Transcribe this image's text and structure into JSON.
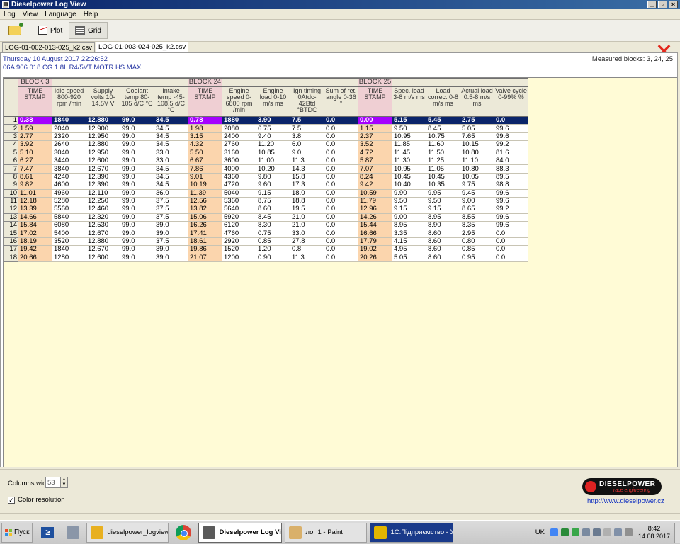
{
  "window": {
    "title": "Dieselpower Log View",
    "buttons": {
      "minimize": "_",
      "maximize": "▫",
      "close": "×"
    }
  },
  "menu": [
    "Log",
    "View",
    "Language",
    "Help"
  ],
  "toolbar": {
    "plot_label": "Plot",
    "grid_label": "Grid"
  },
  "file_tabs": [
    "LOG-01-002-013-025_k2.csv",
    "LOG-01-003-024-025_k2.csv"
  ],
  "info": {
    "date": "Thursday 10 August 2017 22:26:52",
    "engine": "06A 906 018 CG  1.8L R4/5VT MOTR HS MAX",
    "measured_blocks": "Measured blocks: 3, 24, 25"
  },
  "grid": {
    "blocks": [
      {
        "label": "BLOCK 3",
        "span": 1
      },
      {
        "label": "",
        "span": 4
      },
      {
        "label": "BLOCK 24",
        "span": 1
      },
      {
        "label": "",
        "span": 4
      },
      {
        "label": "BLOCK 25",
        "span": 1
      },
      {
        "label": "",
        "span": 4
      }
    ],
    "columns": [
      {
        "label": "TIME STAMP",
        "ts": true,
        "width": 48
      },
      {
        "label": "Idle speed 800-920 rpm /min",
        "width": 48
      },
      {
        "label": "Supply volts 10-14.5V V",
        "width": 48
      },
      {
        "label": "Coolant temp 80-105 d/C °C",
        "width": 48
      },
      {
        "label": "Intake temp -45-108.5 d/C °C",
        "width": 48
      },
      {
        "label": "TIME STAMP",
        "ts": true,
        "width": 48
      },
      {
        "label": "Engine speed 0-6800 rpm /min",
        "width": 48
      },
      {
        "label": "Engine load 0-10 m/s ms",
        "width": 48
      },
      {
        "label": "Ign timing 0Atdc-42Btd °BTDC",
        "width": 48
      },
      {
        "label": "Sum of ret. angle 0-36 °",
        "width": 48
      },
      {
        "label": "TIME STAMP",
        "ts": true,
        "width": 48
      },
      {
        "label": "Spec. load 3-8 m/s ms",
        "width": 48
      },
      {
        "label": "Load correc. 0-8 m/s ms",
        "width": 48
      },
      {
        "label": "Actual load 0.5-8 m/s ms",
        "width": 48
      },
      {
        "label": "Valve cycle 0-99% %",
        "width": 48
      }
    ],
    "selected_row": 0,
    "rows": [
      [
        "0.38",
        "1840",
        "12.880",
        "99.0",
        "34.5",
        "0.78",
        "1880",
        "3.90",
        "7.5",
        "0.0",
        "0.00",
        "5.15",
        "5.45",
        "2.75",
        "0.0"
      ],
      [
        "1.59",
        "2040",
        "12.900",
        "99.0",
        "34.5",
        "1.98",
        "2080",
        "6.75",
        "7.5",
        "0.0",
        "1.15",
        "9.50",
        "8.45",
        "5.05",
        "99.6"
      ],
      [
        "2.77",
        "2320",
        "12.950",
        "99.0",
        "34.5",
        "3.15",
        "2400",
        "9.40",
        "3.8",
        "0.0",
        "2.37",
        "10.95",
        "10.75",
        "7.65",
        "99.6"
      ],
      [
        "3.92",
        "2640",
        "12.880",
        "99.0",
        "34.5",
        "4.32",
        "2760",
        "11.20",
        "6.0",
        "0.0",
        "3.52",
        "11.85",
        "11.60",
        "10.15",
        "99.2"
      ],
      [
        "5.10",
        "3040",
        "12.950",
        "99.0",
        "33.0",
        "5.50",
        "3160",
        "10.85",
        "9.0",
        "0.0",
        "4.72",
        "11.45",
        "11.50",
        "10.80",
        "81.6"
      ],
      [
        "6.27",
        "3440",
        "12.600",
        "99.0",
        "33.0",
        "6.67",
        "3600",
        "11.00",
        "11.3",
        "0.0",
        "5.87",
        "11.30",
        "11.25",
        "11.10",
        "84.0"
      ],
      [
        "7.47",
        "3840",
        "12.670",
        "99.0",
        "34.5",
        "7.86",
        "4000",
        "10.20",
        "14.3",
        "0.0",
        "7.07",
        "10.95",
        "11.05",
        "10.80",
        "88.3"
      ],
      [
        "8.61",
        "4240",
        "12.390",
        "99.0",
        "34.5",
        "9.01",
        "4360",
        "9.80",
        "15.8",
        "0.0",
        "8.24",
        "10.45",
        "10.45",
        "10.05",
        "89.5"
      ],
      [
        "9.82",
        "4600",
        "12.390",
        "99.0",
        "34.5",
        "10.19",
        "4720",
        "9.60",
        "17.3",
        "0.0",
        "9.42",
        "10.40",
        "10.35",
        "9.75",
        "98.8"
      ],
      [
        "11.01",
        "4960",
        "12.110",
        "99.0",
        "36.0",
        "11.39",
        "5040",
        "9.15",
        "18.0",
        "0.0",
        "10.59",
        "9.90",
        "9.95",
        "9.45",
        "99.6"
      ],
      [
        "12.18",
        "5280",
        "12.250",
        "99.0",
        "37.5",
        "12.56",
        "5360",
        "8.75",
        "18.8",
        "0.0",
        "11.79",
        "9.50",
        "9.50",
        "9.00",
        "99.6"
      ],
      [
        "13.39",
        "5560",
        "12.460",
        "99.0",
        "37.5",
        "13.82",
        "5640",
        "8.60",
        "19.5",
        "0.0",
        "12.96",
        "9.15",
        "9.15",
        "8.65",
        "99.2"
      ],
      [
        "14.66",
        "5840",
        "12.320",
        "99.0",
        "37.5",
        "15.06",
        "5920",
        "8.45",
        "21.0",
        "0.0",
        "14.26",
        "9.00",
        "8.95",
        "8.55",
        "99.6"
      ],
      [
        "15.84",
        "6080",
        "12.530",
        "99.0",
        "39.0",
        "16.26",
        "6120",
        "8.30",
        "21.0",
        "0.0",
        "15.44",
        "8.95",
        "8.90",
        "8.35",
        "99.6"
      ],
      [
        "17.02",
        "5400",
        "12.670",
        "99.0",
        "39.0",
        "17.41",
        "4760",
        "0.75",
        "33.0",
        "0.0",
        "16.66",
        "3.35",
        "8.60",
        "2.95",
        "0.0"
      ],
      [
        "18.19",
        "3520",
        "12.880",
        "99.0",
        "37.5",
        "18.61",
        "2920",
        "0.85",
        "27.8",
        "0.0",
        "17.79",
        "4.15",
        "8.60",
        "0.80",
        "0.0"
      ],
      [
        "19.42",
        "1840",
        "12.670",
        "99.0",
        "39.0",
        "19.86",
        "1520",
        "1.20",
        "0.8",
        "0.0",
        "19.02",
        "4.95",
        "8.60",
        "0.85",
        "0.0"
      ],
      [
        "20.66",
        "1280",
        "12.600",
        "99.0",
        "39.0",
        "21.07",
        "1200",
        "0.90",
        "11.3",
        "0.0",
        "20.26",
        "5.05",
        "8.60",
        "0.95",
        "0.0"
      ]
    ]
  },
  "bottom": {
    "columns_width_label": "Columns width:",
    "columns_width_value": "53",
    "color_resolution_label": "Color resolution",
    "color_resolution_checked": true,
    "logo_text": "DIESELPOWER",
    "logo_sub": "race engineering",
    "link": "http://www.dieselpower.cz"
  },
  "taskbar": {
    "start_label": "Пуск",
    "tasks": [
      {
        "label": "dieselpower_logview...",
        "icon": "folder-icon",
        "color": "#e8b020",
        "width": 116
      },
      {
        "label": "",
        "icon": "chrome-icon",
        "width": 34
      },
      {
        "label": "Dieselpower Log Vi...",
        "icon": "logview-icon",
        "color": "#5a5a5a",
        "width": 118,
        "active": true
      },
      {
        "label": "лог 1 - Paint",
        "icon": "paint-icon",
        "color": "#d9b06a",
        "width": 116
      },
      {
        "label": "1С:Підприємство - У...",
        "icon": "onec-icon",
        "color": "#e2b500",
        "width": 118,
        "dark": true
      }
    ],
    "language": "UK",
    "time": "8:42",
    "date": "14.08.2017"
  }
}
